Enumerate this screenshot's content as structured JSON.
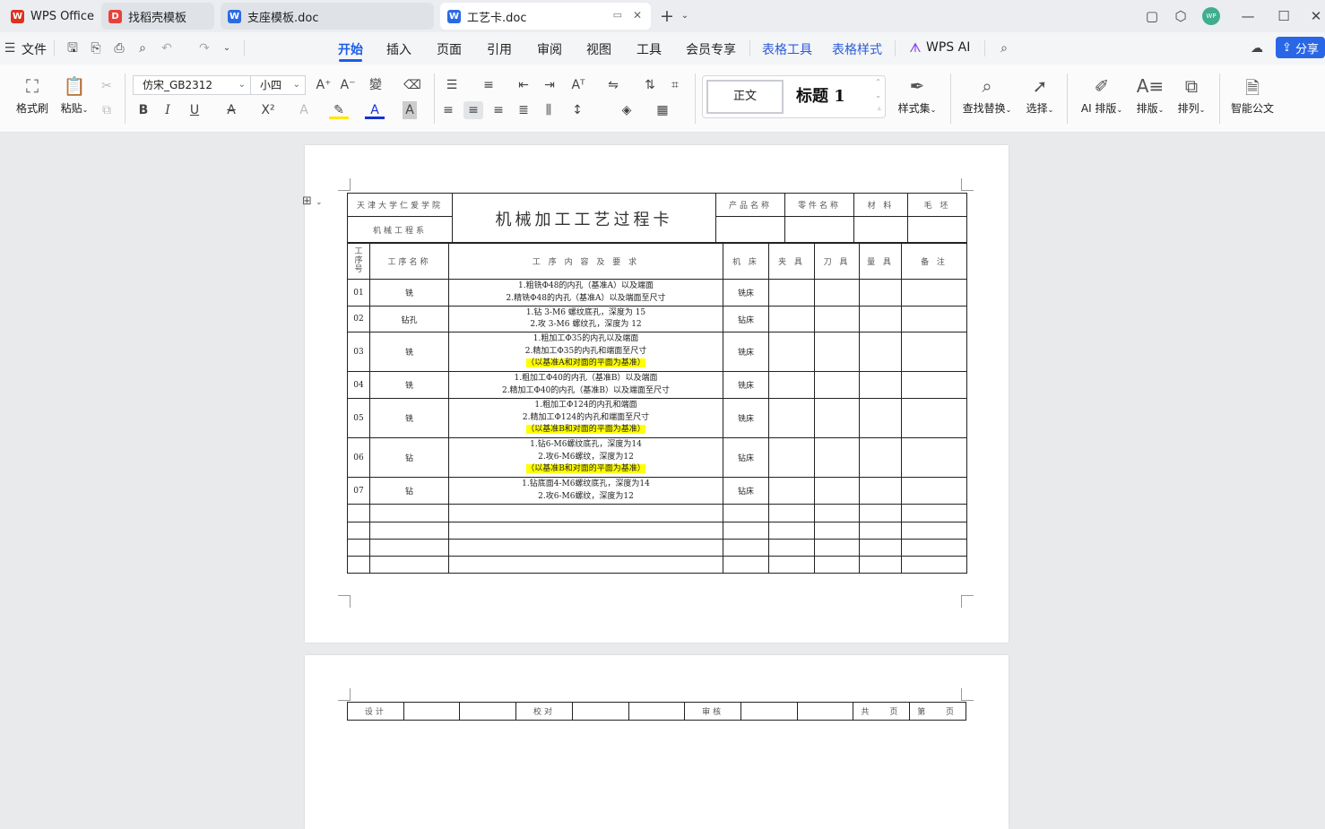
{
  "titlebar": {
    "tabs": [
      {
        "label": "WPS Office",
        "icon": "wps-logo-icon",
        "color": "#e0301e"
      },
      {
        "label": "找稻壳模板",
        "icon": "docer-icon",
        "color": "#e8413a"
      },
      {
        "label": "支座模板.doc",
        "icon": "word-doc-icon",
        "color": "#2b6ae6"
      },
      {
        "label": "工艺卡.doc",
        "icon": "word-doc-icon",
        "color": "#2b6ae6"
      }
    ],
    "avatar": "WP"
  },
  "menubar": {
    "file": "文件",
    "items": [
      "开始",
      "插入",
      "页面",
      "引用",
      "审阅",
      "视图",
      "工具",
      "会员专享",
      "表格工具",
      "表格样式",
      "WPS AI"
    ],
    "active": "开始",
    "share": "分享"
  },
  "ribbon": {
    "format_painter": "格式刷",
    "paste": "粘贴",
    "font_name": "仿宋_GB2312",
    "font_size": "小四",
    "style_normal": "正文",
    "style_heading": "标题 1",
    "styles": "样式集",
    "find_replace": "查找替换",
    "select": "选择",
    "ai_layout": "AI 排版",
    "layout": "排版",
    "arrange": "排列",
    "smart_doc": "智能公文"
  },
  "doc": {
    "header": {
      "school": "天津大学仁爱学院",
      "dept": "机械工程系",
      "title": "机械加工工艺过程卡",
      "product": "产品名称",
      "part": "零件名称",
      "material": "材 料",
      "blank": "毛 坯"
    },
    "columns": [
      "工序号",
      "工序名称",
      "工 序 内 容 及 要 求",
      "机 床",
      "夹 具",
      "刀 具",
      "量 具",
      "备 注"
    ],
    "rows": [
      {
        "no": "01",
        "name": "铣",
        "lines": [
          "1.粗铣Φ48的内孔（基准A）以及端面",
          "2.精铣Φ48的内孔（基准A）以及端面至尺寸"
        ],
        "hl": "",
        "machine": "铣床"
      },
      {
        "no": "02",
        "name": "钻孔",
        "lines": [
          "1.钻 3-M6 螺纹底孔，深度为 15",
          "2.攻 3-M6 螺纹孔，深度为 12"
        ],
        "hl": "",
        "machine": "钻床"
      },
      {
        "no": "03",
        "name": "铣",
        "lines": [
          "1.粗加工Φ35的内孔以及端面",
          "2.精加工Φ35的内孔和端面至尺寸"
        ],
        "hl": "（以基准A和对面的平面为基准）",
        "machine": "铣床"
      },
      {
        "no": "04",
        "name": "铣",
        "lines": [
          "1.粗加工Φ40的内孔（基准B）以及端面",
          "2.精加工Φ40的内孔（基准B）以及端面至尺寸"
        ],
        "hl": "",
        "machine": "铣床"
      },
      {
        "no": "05",
        "name": "铣",
        "lines": [
          "1.粗加工Φ124的内孔和端面",
          "2.精加工Φ124的内孔和端面至尺寸"
        ],
        "hl": "（以基准B和对面的平面为基准）",
        "machine": "铣床"
      },
      {
        "no": "06",
        "name": "钻",
        "lines": [
          "1.钻6-M6螺纹底孔，深度为14",
          "2.攻6-M6螺纹，深度为12"
        ],
        "hl": "（以基准B和对面的平面为基准）",
        "machine": "钻床"
      },
      {
        "no": "07",
        "name": "钻",
        "lines": [
          "1.钻底面4-M6螺纹底孔，深度为14",
          "2.攻6-M6螺纹，深度为12"
        ],
        "hl": "",
        "machine": "钻床"
      }
    ],
    "footer": [
      "设计",
      "",
      "",
      "校对",
      "",
      "",
      "审核",
      "",
      "",
      "共 页",
      "第 页"
    ]
  }
}
